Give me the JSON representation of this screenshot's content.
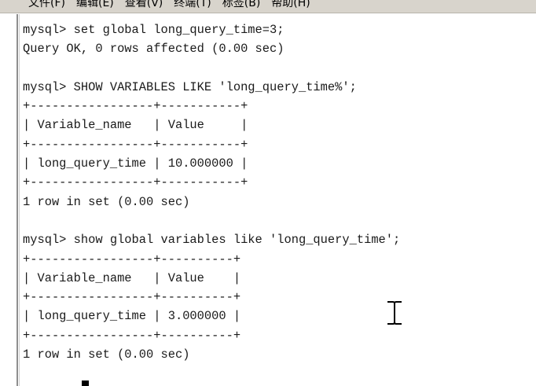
{
  "menubar": {
    "items": [
      {
        "label": "文件(F)"
      },
      {
        "label": "编辑(E)"
      },
      {
        "label": "查看(V)"
      },
      {
        "label": "终端(T)"
      },
      {
        "label": "标签(B)"
      },
      {
        "label": "帮助(H)"
      }
    ]
  },
  "terminal": {
    "lines": [
      "mysql> set global long_query_time=3;",
      "Query OK, 0 rows affected (0.00 sec)",
      "",
      "mysql> SHOW VARIABLES LIKE 'long_query_time%';",
      "+-----------------+-----------+",
      "| Variable_name   | Value     |",
      "+-----------------+-----------+",
      "| long_query_time | 10.000000 |",
      "+-----------------+-----------+",
      "1 row in set (0.00 sec)",
      "",
      "mysql> show global variables like 'long_query_time';",
      "+-----------------+----------+",
      "| Variable_name   | Value    |",
      "+-----------------+----------+",
      "| long_query_time | 3.000000 |",
      "+-----------------+----------+",
      "1 row in set (0.00 sec)"
    ]
  },
  "icons": {
    "mouse_pointer": "i-beam-cursor-icon",
    "text_cursor": "block-cursor"
  }
}
